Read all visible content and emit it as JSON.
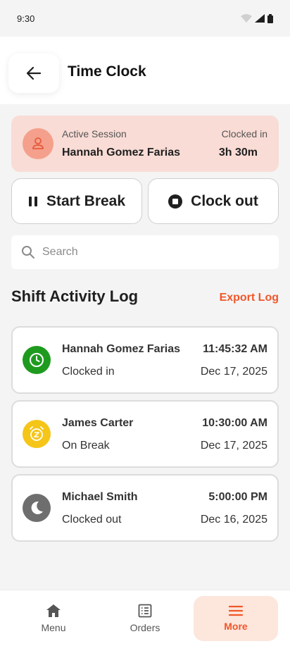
{
  "status_bar": {
    "time": "9:30"
  },
  "header": {
    "title": "Time Clock",
    "back_icon": "arrow-left-icon"
  },
  "session": {
    "label": "Active Session",
    "name": "Hannah Gomez Farias",
    "clock_label": "Clocked in",
    "clock_value": "3h 30m",
    "accent": "#f4a08d",
    "bg": "#f9dcd5"
  },
  "actions": {
    "break_label": "Start Break",
    "clockout_label": "Clock out"
  },
  "search": {
    "placeholder": "Search",
    "value": ""
  },
  "log": {
    "title": "Shift Activity Log",
    "export_label": "Export Log",
    "entries": [
      {
        "name": "Hannah Gomez Farias",
        "status": "Clocked in",
        "time": "11:45:32 AM",
        "date": "Dec 17, 2025",
        "icon": "clock-icon",
        "color": "#1e9b1e"
      },
      {
        "name": "James Carter",
        "status": "On Break",
        "time": "10:30:00 AM",
        "date": "Dec 17, 2025",
        "icon": "alarm-snooze-icon",
        "color": "#f5c518"
      },
      {
        "name": "Michael Smith",
        "status": "Clocked out",
        "time": "5:00:00 PM",
        "date": "Dec 16, 2025",
        "icon": "moon-icon",
        "color": "#6e6e6e"
      }
    ]
  },
  "nav": {
    "items": [
      {
        "label": "Menu",
        "icon": "home-icon"
      },
      {
        "label": "Orders",
        "icon": "receipt-icon"
      },
      {
        "label": "More",
        "icon": "hamburger-icon"
      }
    ],
    "active_color": "#f0572a"
  }
}
